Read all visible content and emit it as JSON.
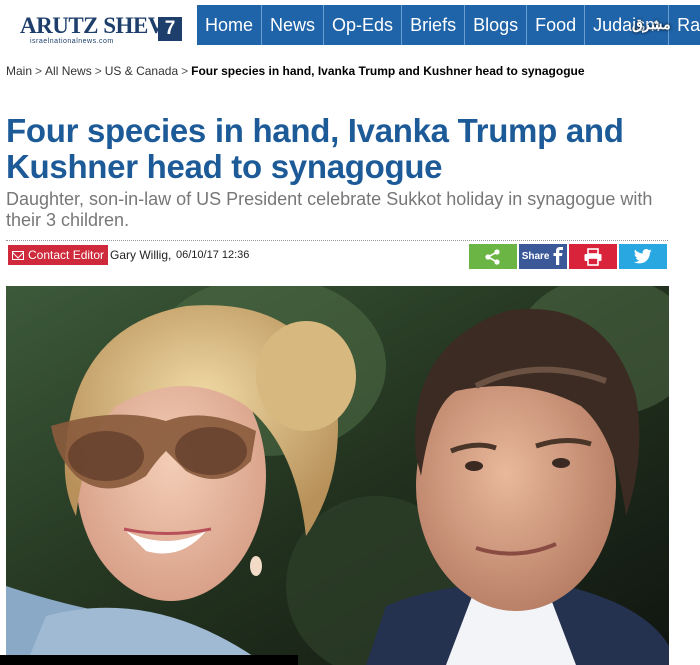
{
  "header": {
    "logo_text": "ARUTZ SHEVA",
    "logo_number": "7",
    "logo_sub": "israelnationalnews.com",
    "nav": [
      "Home",
      "News",
      "Op-Eds",
      "Briefs",
      "Blogs",
      "Food",
      "Judaism",
      "Radio"
    ],
    "watermark": "مشرق"
  },
  "breadcrumb": {
    "items": [
      "Main",
      "All News",
      "US & Canada"
    ],
    "separator": ">",
    "current": "Four species in hand, Ivanka Trump and Kushner head to synagogue"
  },
  "article": {
    "title": "Four species in hand, Ivanka Trump and Kushner head to synagogue",
    "subtitle": "Daughter, son-in-law of US President celebrate Sukkot holiday in synagogue with their 3 children.",
    "contact_label": "Contact Editor",
    "author": "Gary Willig,",
    "date": "06/10/17 12:36"
  },
  "share": {
    "share_icon": "share-icon",
    "facebook_label": "Share",
    "print_icon": "print-icon",
    "twitter_icon": "twitter-icon"
  },
  "colors": {
    "nav_bg": "#1f63a8",
    "title": "#1d5a98",
    "contact_bg": "#cf2a3b",
    "share_green": "#6bb545",
    "facebook_blue": "#3b5998",
    "print_red": "#d9233a",
    "twitter_blue": "#29a7e1"
  }
}
